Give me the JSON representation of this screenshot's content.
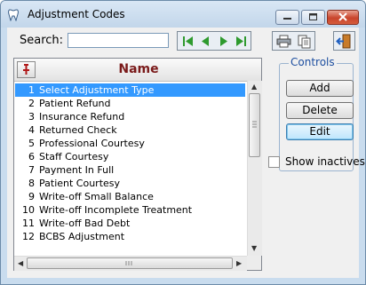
{
  "window": {
    "title": "Adjustment Codes"
  },
  "search": {
    "label": "Search:",
    "value": ""
  },
  "grid": {
    "column_header": "Name",
    "rows": [
      {
        "num": "1",
        "name": "Select Adjustment Type"
      },
      {
        "num": "2",
        "name": "Patient Refund"
      },
      {
        "num": "3",
        "name": "Insurance Refund"
      },
      {
        "num": "4",
        "name": "Returned Check"
      },
      {
        "num": "5",
        "name": "Professional Courtesy"
      },
      {
        "num": "6",
        "name": "Staff Courtesy"
      },
      {
        "num": "7",
        "name": "Payment In Full"
      },
      {
        "num": "8",
        "name": "Patient Courtesy"
      },
      {
        "num": "9",
        "name": "Write-off Small Balance"
      },
      {
        "num": "10",
        "name": "Write-off Incomplete Treatment"
      },
      {
        "num": "11",
        "name": "Write-off Bad Debt"
      },
      {
        "num": "12",
        "name": "BCBS Adjustment"
      }
    ],
    "selected_index": 0
  },
  "controls": {
    "legend": "Controls",
    "add_label": "Add",
    "delete_label": "Delete",
    "edit_label": "Edit"
  },
  "show_inactives": {
    "label": "Show inactives",
    "checked": false
  },
  "colors": {
    "selection": "#3399ff",
    "header_text": "#7a1a1a",
    "legend_text": "#1e4fa0",
    "nav_green": "#2e9a2e"
  }
}
